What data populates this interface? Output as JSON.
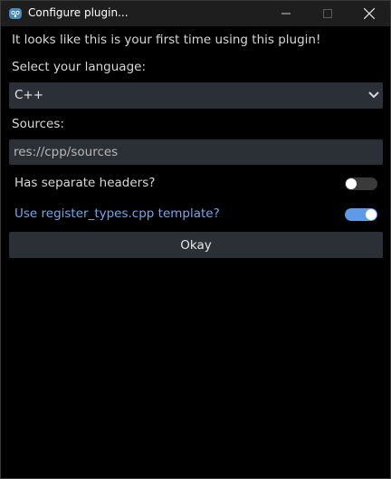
{
  "window": {
    "title": "Configure plugin..."
  },
  "form": {
    "intro": "It looks like this is your first time using this plugin!",
    "language_label": "Select your language:",
    "language_value": "C++",
    "sources_label": "Sources:",
    "sources_value": "res://cpp/sources",
    "separate_headers_label": "Has separate headers?",
    "separate_headers_on": false,
    "register_types_label": "Use register_types.cpp template?",
    "register_types_on": true,
    "okay_label": "Okay"
  },
  "colors": {
    "accent": "#5f9ae6",
    "label_highlight": "#74a7ea",
    "field_bg": "#2b2f36",
    "titlebar_bg": "#1e1e1e"
  },
  "icons": {
    "app": "godot-icon",
    "minimize": "minimize-icon",
    "maximize": "maximize-icon",
    "close": "close-icon",
    "dropdown": "chevron-down-icon"
  }
}
